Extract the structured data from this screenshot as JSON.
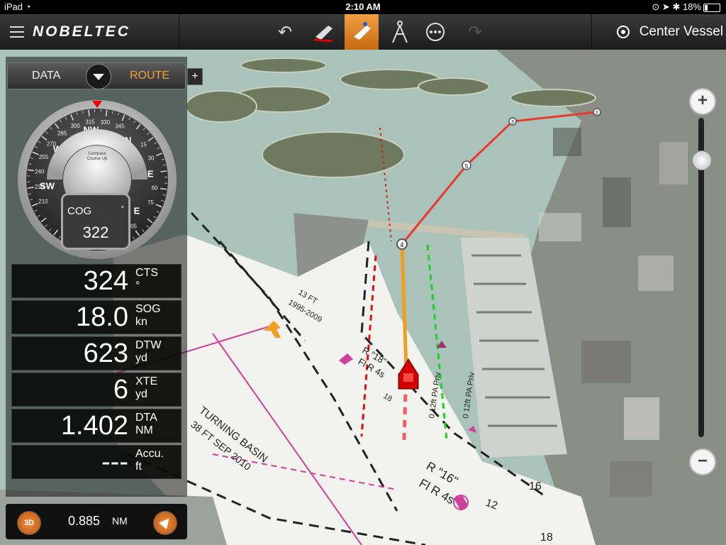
{
  "status_bar": {
    "device": "iPad",
    "time": "2:10 AM",
    "battery": "18%",
    "battery_level": 0.18
  },
  "toolbar": {
    "brand": "NOBELTEC",
    "center_vessel_label": "Center Vessel"
  },
  "panel": {
    "mode_left": "DATA",
    "mode_right": "ROUTE",
    "add_label": "+",
    "compass": {
      "heading_degrees": 322,
      "mode_label_line1": "Compass",
      "mode_label_line2": "Course Up",
      "cardinal_labels": [
        "NW",
        "N",
        "NE",
        "E",
        "SE",
        "S",
        "SW",
        "W"
      ],
      "tick_labels": [
        "285",
        "300",
        "315",
        "330",
        "345",
        "15",
        "30",
        "60",
        "75",
        "105",
        "120",
        "135",
        "240",
        "225",
        "210",
        "255",
        "270",
        "150"
      ]
    },
    "cog": {
      "label": "COG",
      "unit": "°",
      "value": "322"
    },
    "data_rows": [
      {
        "value": "324",
        "label": "CTS",
        "unit": "°"
      },
      {
        "value": "18.0",
        "label": "SOG",
        "unit": "kn"
      },
      {
        "value": "623",
        "label": "DTW",
        "unit": "yd"
      },
      {
        "value": "6",
        "label": "XTE",
        "unit": "yd"
      },
      {
        "value": "1.402",
        "label": "DTA",
        "unit": "NM"
      },
      {
        "value": "---",
        "label": "Accu.",
        "unit": "ft"
      }
    ]
  },
  "bottom_bar": {
    "mode_3d_label": "3D",
    "scale_value": "0.885",
    "scale_unit": "NM"
  },
  "zoom": {
    "in_label": "+",
    "out_label": "−",
    "level": 0.87
  },
  "map": {
    "annotations": [
      "TURNING BASIN",
      "38 FT SEP 2010",
      "R \"16\"",
      "Fl R 4s",
      "R \"18\"",
      "Fl R 4s",
      "16",
      "12",
      "18",
      "18",
      "13 FT",
      "1995-2009",
      "0 12ft PA Priv",
      "0 12ft PA Priv"
    ],
    "waypoints": [
      "4",
      "5",
      "3",
      "2"
    ],
    "colors": {
      "route": "#e83a2a",
      "water": "#a9c3bb",
      "channel": "#f2f2ee",
      "boat": "#d40000"
    }
  }
}
